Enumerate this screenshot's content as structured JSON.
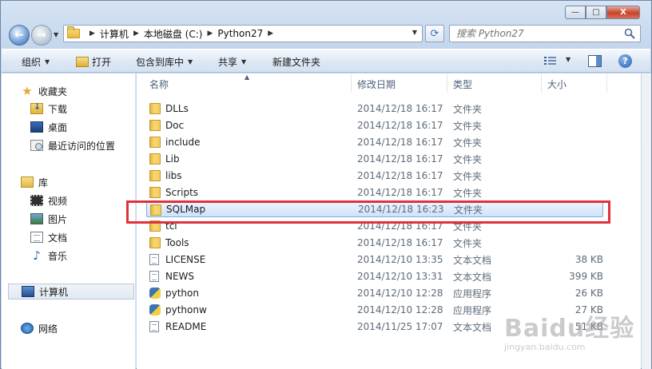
{
  "window": {
    "min_label": "—",
    "max_label": "□",
    "close_label": "X"
  },
  "address": {
    "crumbs": [
      "计算机",
      "本地磁盘 (C:)",
      "Python27"
    ]
  },
  "search": {
    "placeholder": "搜索 Python27"
  },
  "toolbar": {
    "organize": "组织",
    "open": "打开",
    "include": "包含到库中",
    "share": "共享",
    "new_folder": "新建文件夹"
  },
  "nav": {
    "favorites": "收藏夹",
    "downloads": "下载",
    "desktop": "桌面",
    "recent": "最近访问的位置",
    "libraries": "库",
    "videos": "视频",
    "pictures": "图片",
    "documents": "文档",
    "music": "音乐",
    "computer": "计算机",
    "network": "网络"
  },
  "columns": {
    "name": "名称",
    "date": "修改日期",
    "type": "类型",
    "size": "大小"
  },
  "files": [
    {
      "name": "DLLs",
      "date": "2014/12/18 16:17",
      "type": "文件夹",
      "size": "",
      "icon": "folder-icon"
    },
    {
      "name": "Doc",
      "date": "2014/12/18 16:17",
      "type": "文件夹",
      "size": "",
      "icon": "folder-icon"
    },
    {
      "name": "include",
      "date": "2014/12/18 16:17",
      "type": "文件夹",
      "size": "",
      "icon": "folder-icon"
    },
    {
      "name": "Lib",
      "date": "2014/12/18 16:17",
      "type": "文件夹",
      "size": "",
      "icon": "folder-icon"
    },
    {
      "name": "libs",
      "date": "2014/12/18 16:17",
      "type": "文件夹",
      "size": "",
      "icon": "folder-icon"
    },
    {
      "name": "Scripts",
      "date": "2014/12/18 16:17",
      "type": "文件夹",
      "size": "",
      "icon": "folder-icon"
    },
    {
      "name": "SQLMap",
      "date": "2014/12/18 16:23",
      "type": "文件夹",
      "size": "",
      "icon": "folder-icon",
      "selected": true
    },
    {
      "name": "tcl",
      "date": "2014/12/18 16:17",
      "type": "文件夹",
      "size": "",
      "icon": "folder-icon"
    },
    {
      "name": "Tools",
      "date": "2014/12/18 16:17",
      "type": "文件夹",
      "size": "",
      "icon": "folder-icon"
    },
    {
      "name": "LICENSE",
      "date": "2014/12/10 13:35",
      "type": "文本文档",
      "size": "38 KB",
      "icon": "text-file-icon"
    },
    {
      "name": "NEWS",
      "date": "2014/12/10 13:31",
      "type": "文本文档",
      "size": "399 KB",
      "icon": "text-file-icon"
    },
    {
      "name": "python",
      "date": "2014/12/10 12:28",
      "type": "应用程序",
      "size": "26 KB",
      "icon": "python-app-icon"
    },
    {
      "name": "pythonw",
      "date": "2014/12/10 12:28",
      "type": "应用程序",
      "size": "27 KB",
      "icon": "python-app-icon"
    },
    {
      "name": "README",
      "date": "2014/11/25 17:07",
      "type": "文本文档",
      "size": "51 KB",
      "icon": "text-file-icon"
    }
  ],
  "watermark": {
    "brand": "Baidu经验",
    "url": "jingyan.baidu.com"
  },
  "colors": {
    "highlight": "#e0313b",
    "selected_row": "#cfe3fa"
  }
}
